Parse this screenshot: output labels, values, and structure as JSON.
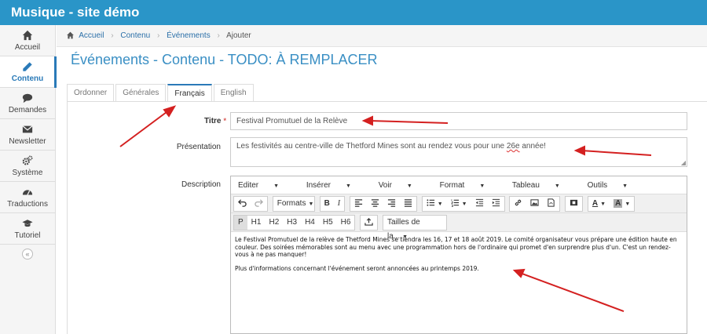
{
  "app": {
    "title": "Musique - site démo"
  },
  "sidebar": {
    "items": [
      {
        "label": "Accueil",
        "icon": "home-icon"
      },
      {
        "label": "Contenu",
        "icon": "pencil-icon",
        "active": true
      },
      {
        "label": "Demandes",
        "icon": "comment-icon"
      },
      {
        "label": "Newsletter",
        "icon": "envelope-icon"
      },
      {
        "label": "Système",
        "icon": "cogs-icon"
      },
      {
        "label": "Traductions",
        "icon": "dashboard-icon"
      },
      {
        "label": "Tutoriel",
        "icon": "graduation-cap-icon"
      }
    ],
    "collapse_glyph": "«"
  },
  "breadcrumb": {
    "items": [
      "Accueil",
      "Contenu",
      "Événements",
      "Ajouter"
    ],
    "separator": "›"
  },
  "page": {
    "title": "Événements - Contenu - TODO: À REMPLACER"
  },
  "tabs": [
    {
      "label": "Ordonner"
    },
    {
      "label": "Générales"
    },
    {
      "label": "Français",
      "active": true
    },
    {
      "label": "English"
    }
  ],
  "form": {
    "title_label": "Titre",
    "title_required_mark": "*",
    "title_value": "Festival Promutuel de la Relève",
    "presentation_label": "Présentation",
    "presentation_value_before": "Les festivités au centre-ville de Thetford Mines sont au rendez vous pour une ",
    "presentation_value_misspelled": "26e",
    "presentation_value_after": " année!",
    "description_label": "Description"
  },
  "editor": {
    "menu": [
      "Editer",
      "Insérer",
      "Voir",
      "Format",
      "Tableau",
      "Outils"
    ],
    "formats_label": "Formats",
    "bold_label": "B",
    "italic_label": "I",
    "block_buttons": [
      "P",
      "H1",
      "H2",
      "H3",
      "H4",
      "H5",
      "H6"
    ],
    "font_sizes_label": "Tailles de la...",
    "color_label": "A",
    "paragraphs": [
      "Le Festival Promutuel de la relève de Thetford Mines se tiendra les 16, 17 et 18 août 2019. Le comité organisateur vous prépare une édition haute en couleur. Des soirées mémorables sont au menu avec une programmation hors de l'ordinaire qui promet d'en surprendre plus d'un. C'est un rendez-vous à ne pas manquer!",
      "Plus d'informations concernant l'événement seront annoncées au printemps 2019."
    ]
  },
  "colors": {
    "topbar": "#2a95c8",
    "accent": "#2a7ab8",
    "title": "#3a8fc4",
    "required": "#d9534f",
    "annotation_arrow": "#d42020"
  }
}
